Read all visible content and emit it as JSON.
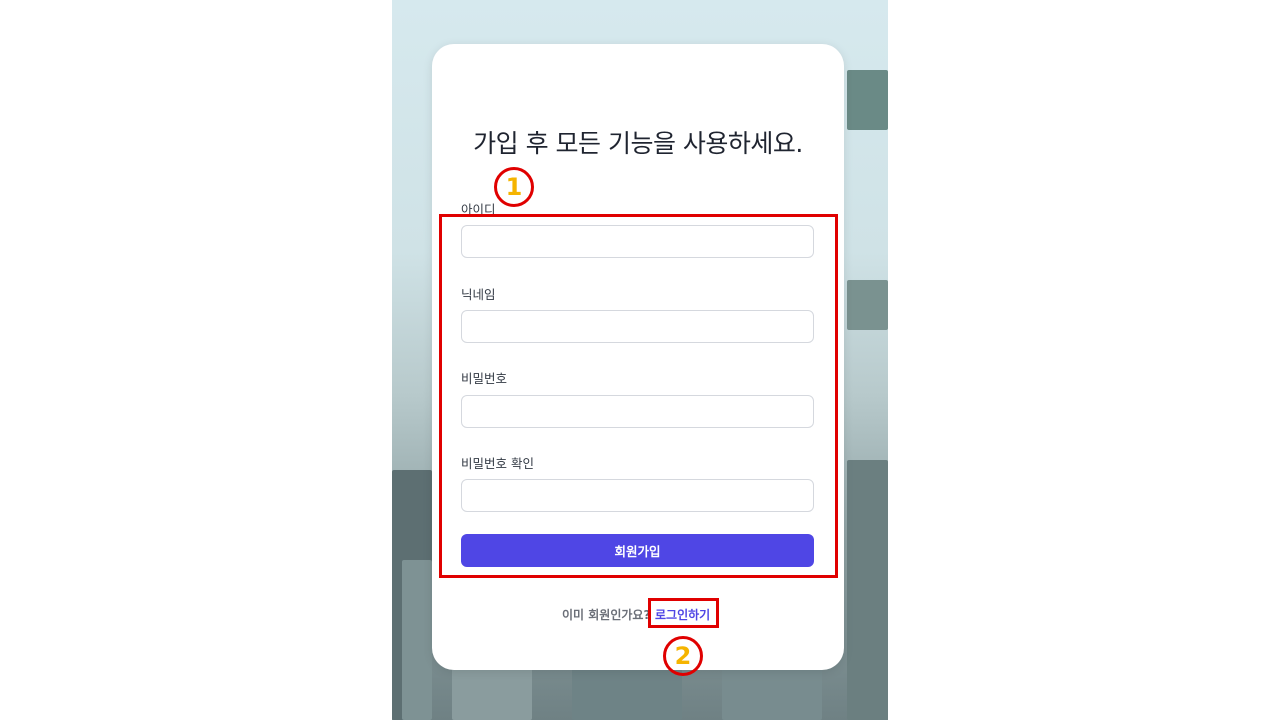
{
  "page": {
    "title": "가입 후 모든 기능을 사용하세요.",
    "fields": [
      {
        "label": "아이디",
        "value": "",
        "placeholder": ""
      },
      {
        "label": "닉네임",
        "value": "",
        "placeholder": ""
      },
      {
        "label": "비밀번호",
        "value": "",
        "placeholder": ""
      },
      {
        "label": "비밀번호 확인",
        "value": "",
        "placeholder": ""
      }
    ],
    "submit_label": "회원가입",
    "footer_text": "이미 회원인가요?",
    "login_link": "로그인하기"
  },
  "annotations": {
    "callout_1": "1",
    "callout_2": "2",
    "highlight_color": "#e00000",
    "callout_color": "#f5b400"
  },
  "colors": {
    "accent": "#4f46e5"
  }
}
